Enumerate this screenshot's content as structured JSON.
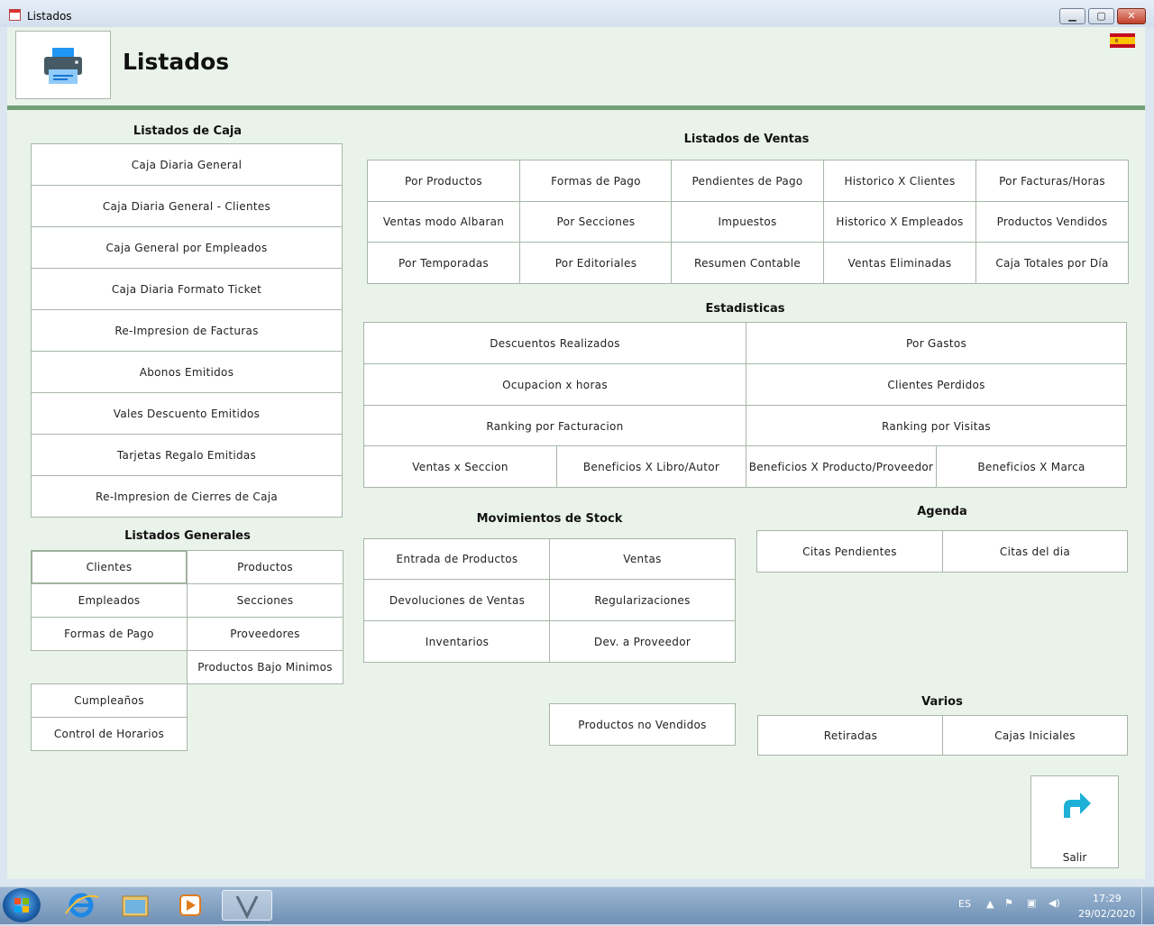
{
  "window": {
    "title": "Listados",
    "min_label": "▁",
    "max_label": "▢",
    "close_label": "✕"
  },
  "header": {
    "title": "Listados"
  },
  "caja": {
    "title": "Listados de Caja",
    "items": [
      "Caja Diaria General",
      "Caja Diaria General - Clientes",
      "Caja General por Empleados",
      "Caja Diaria Formato Ticket",
      "Re-Impresion de Facturas",
      "Abonos Emitidos",
      "Vales Descuento Emitidos",
      "Tarjetas Regalo Emitidas",
      "Re-Impresion de Cierres de Caja"
    ]
  },
  "generales": {
    "title": "Listados Generales",
    "items": [
      "Clientes",
      "Productos",
      "Empleados",
      "Secciones",
      "Formas de Pago",
      "Proveedores",
      "Productos Bajo Minimos",
      "Cumpleaños",
      "Control de Horarios"
    ]
  },
  "ventas": {
    "title": "Listados de Ventas",
    "items": [
      "Por Productos",
      "Formas de Pago",
      "Pendientes de Pago",
      "Historico X Clientes",
      "Por Facturas/Horas",
      "Ventas modo Albaran",
      "Por Secciones",
      "Impuestos",
      "Historico X Empleados",
      "Productos Vendidos",
      "Por Temporadas",
      "Por Editoriales",
      "Resumen Contable",
      "Ventas Eliminadas",
      "Caja Totales por Día"
    ]
  },
  "estadisticas": {
    "title": "Estadisticas",
    "items": [
      "Descuentos Realizados",
      "Por Gastos",
      "Ocupacion x horas",
      "Clientes Perdidos",
      "Ranking por Facturacion",
      "Ranking por Visitas",
      "Ventas x Seccion",
      "Beneficios X Libro/Autor",
      "Beneficios X Producto/Proveedor",
      "Beneficios X Marca"
    ]
  },
  "stock": {
    "title": "Movimientos de Stock",
    "items": [
      "Entrada de Productos",
      "Ventas",
      "Devoluciones de Ventas",
      "Regularizaciones",
      "Inventarios",
      "Dev. a Proveedor",
      "Productos no Vendidos"
    ]
  },
  "agenda": {
    "title": "Agenda",
    "items": [
      "Citas Pendientes",
      "Citas del dia"
    ]
  },
  "varios": {
    "title": "Varios",
    "items": [
      "Retiradas",
      "Cajas Iniciales"
    ]
  },
  "salir": {
    "label": "Salir"
  },
  "taskbar": {
    "lang": "ES",
    "time": "17:29",
    "date": "29/02/2020"
  },
  "colors": {
    "accent_bar": "#6fa077",
    "background": "#eaf3ea",
    "exit_arrow": "#1eb0d6"
  }
}
